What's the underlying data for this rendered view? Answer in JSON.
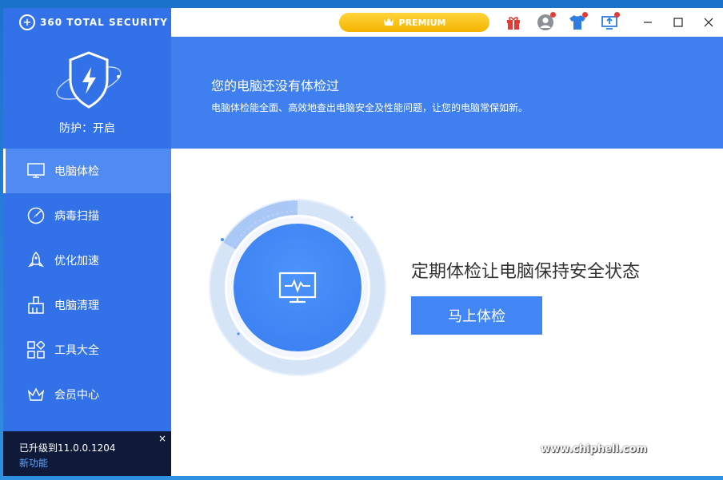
{
  "app": {
    "brand_text": "360 TOTAL SECURITY",
    "protection_status": "防护：开启"
  },
  "sidebar": {
    "items": [
      {
        "label": "电脑体检",
        "icon": "monitor-icon",
        "active": true
      },
      {
        "label": "病毒扫描",
        "icon": "radar-icon",
        "active": false
      },
      {
        "label": "优化加速",
        "icon": "rocket-icon",
        "active": false
      },
      {
        "label": "电脑清理",
        "icon": "broom-icon",
        "active": false
      },
      {
        "label": "工具大全",
        "icon": "grid-icon",
        "active": false
      },
      {
        "label": "会员中心",
        "icon": "crown-icon",
        "active": false
      }
    ]
  },
  "update": {
    "version_text": "已升级到11.0.0.1204",
    "features_link": "新功能",
    "close_glyph": "×"
  },
  "topbar": {
    "premium_label": "PREMIUM",
    "icons": [
      "gift-icon",
      "user-icon",
      "tshirt-icon",
      "upload-icon"
    ],
    "window_controls": [
      "minimize",
      "maximize",
      "close"
    ]
  },
  "banner": {
    "title": "您的电脑还没有体检过",
    "subtitle": "电脑体检能全面、高效地查出电脑安全及性能问题，让您的电脑常保如新。"
  },
  "main": {
    "tagline": "定期体检让电脑保持安全状态",
    "cta_label": "马上体检"
  },
  "watermark": {
    "url": "www.chiphell.com"
  },
  "colors": {
    "sidebar": "#3371e8",
    "active_item": "#4f8bf2",
    "banner": "#3f7ff0",
    "button": "#4285f4",
    "premium": "#f5b400",
    "update_bar": "#0f1a3a"
  }
}
